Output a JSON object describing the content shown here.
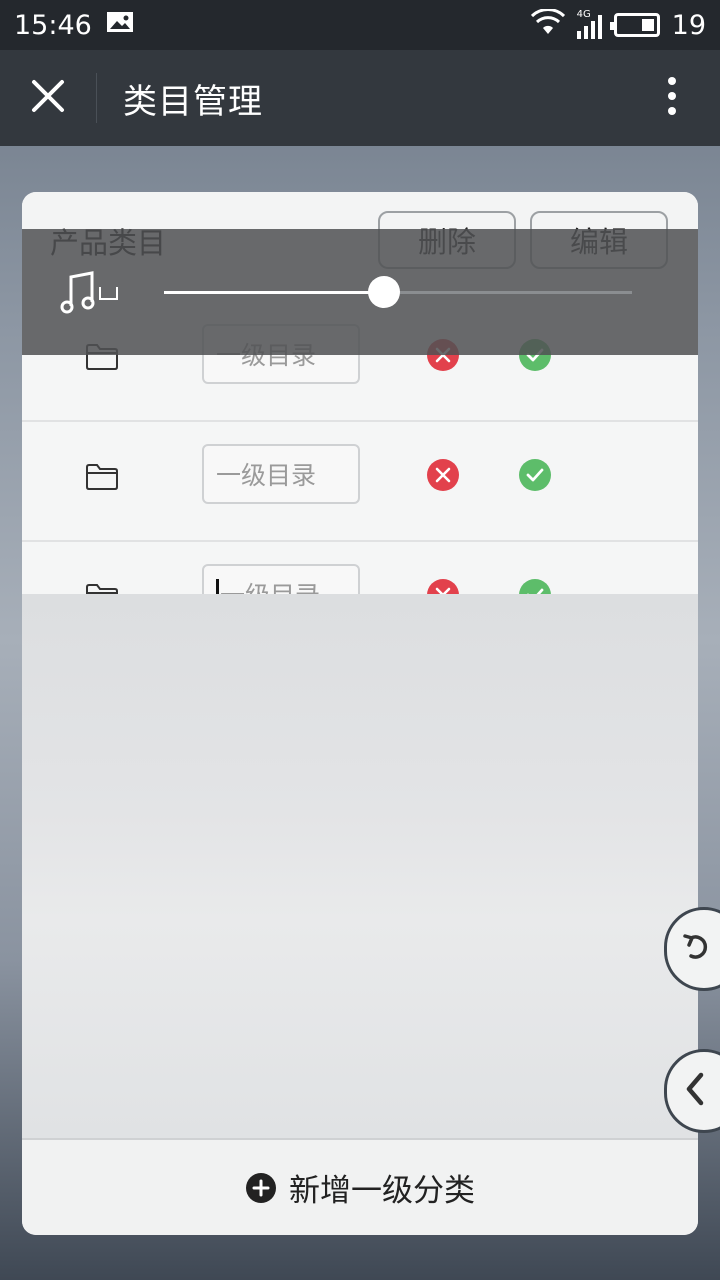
{
  "status_bar": {
    "time": "15:46",
    "network": "4G",
    "battery_level": "19"
  },
  "navbar": {
    "title": "类目管理",
    "close_icon": "close-icon",
    "more_icon": "more-vertical-icon"
  },
  "card": {
    "title": "产品类目",
    "delete_label": "删除",
    "edit_label": "编辑",
    "rows": [
      {
        "placeholder": "一级目录",
        "focused": false
      },
      {
        "placeholder": "一级目录",
        "focused": false
      },
      {
        "placeholder": "一级目录",
        "focused": true
      }
    ],
    "add_label": "新增一级分类"
  },
  "music_player": {
    "icon": "music-note-icon",
    "progress_percent": 47
  },
  "colors": {
    "cancel_red": "#e2414c",
    "confirm_green": "#5dbd6a",
    "navbar_bg": "#33383e",
    "status_bg": "#24282d"
  },
  "side_buttons": [
    "undo-icon",
    "chevron-left-icon"
  ]
}
